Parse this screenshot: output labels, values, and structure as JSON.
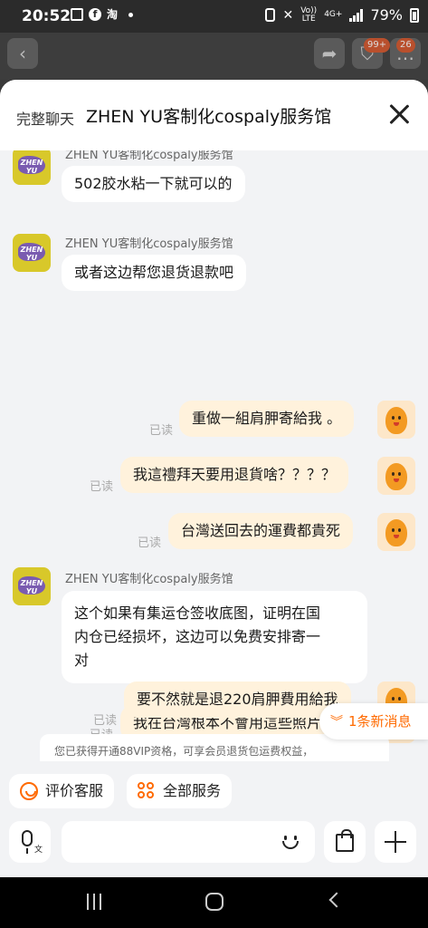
{
  "status_bar": {
    "time": "20:52",
    "notification_icons": [
      "gallery-icon",
      "facebook-icon",
      "taobao-icon"
    ],
    "volte": "Vo))",
    "lte_label": "LTE",
    "network": "4G+",
    "battery": "79%"
  },
  "background_app": {
    "cart_badge": "99+",
    "msg_badge": "26"
  },
  "header": {
    "full_chat_label": "完整聊天",
    "shop_title": "ZHEN YU客制化cospaly服务馆"
  },
  "shop_avatar_text": "ZHEN YU",
  "messages": [
    {
      "sender": "ZHEN YU客制化cospaly服务馆",
      "side": "shop",
      "lines": [
        "502胶水粘一下就可以的"
      ]
    },
    {
      "sender": "ZHEN YU客制化cospaly服务馆",
      "side": "shop",
      "lines": [
        "或者这边帮您退货退款吧"
      ]
    },
    {
      "side": "me",
      "read": "已读",
      "lines": [
        "重做一組肩胛寄給我 。"
      ]
    },
    {
      "side": "me",
      "read": "已读",
      "lines": [
        "我這禮拜天要用退貨啥？？？？"
      ]
    },
    {
      "side": "me",
      "read": "已读",
      "lines": [
        "台灣送回去的運費都貴死"
      ]
    },
    {
      "sender": "ZHEN YU客制化cospaly服务馆",
      "side": "shop",
      "lines": [
        "这个如果有集运仓签收底图，证明在国",
        "内仓已经损坏，这边可以免费安排寄一",
        "对"
      ]
    },
    {
      "side": "me",
      "read": "已读",
      "lines": [
        "我在台灣根本不會用這些照片。"
      ]
    },
    {
      "side": "me",
      "read": "已读",
      "lines": [
        "要不然就是退220肩胛費用給我"
      ]
    }
  ],
  "new_messages_label": "1条新消息",
  "vip_tip": "您已获得开通88VIP资格，可享会员退货包运费权益，",
  "quick_actions": {
    "rate_service": "评价客服",
    "all_services": "全部服务"
  },
  "input": {
    "voice_label": "文",
    "placeholder": ""
  },
  "colors": {
    "accent": "#ff6a00",
    "my_bubble": "#fff2dc",
    "shop_bubble": "#ffffff",
    "background": "#f2f3f5"
  }
}
